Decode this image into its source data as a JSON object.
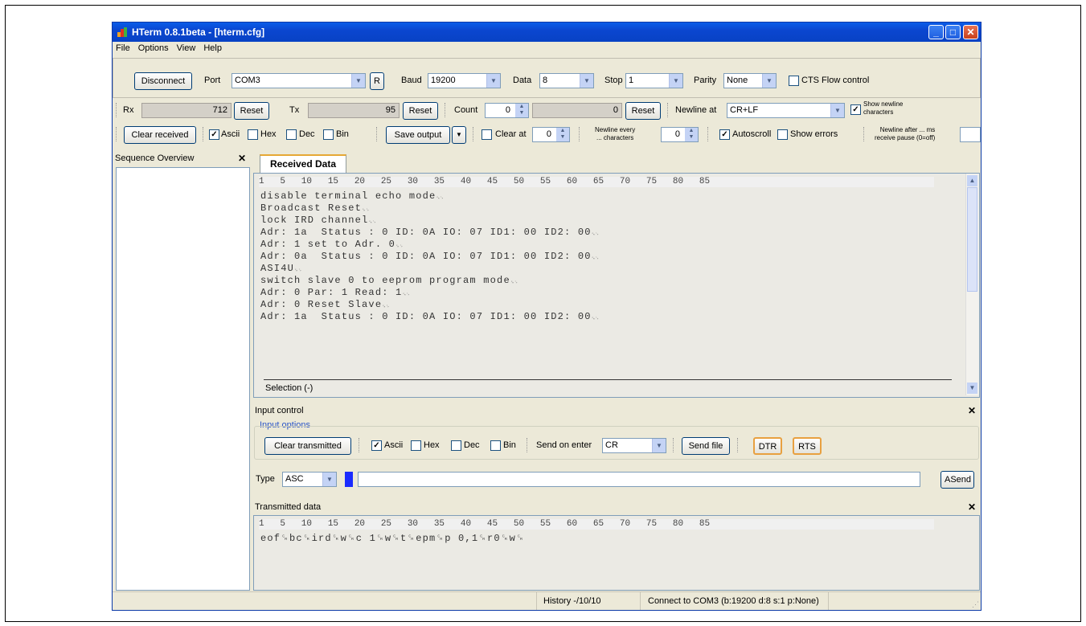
{
  "window": {
    "title": "HTerm 0.8.1beta - [hterm.cfg]",
    "minimize_glyph": "_",
    "maximize_glyph": "□",
    "close_glyph": "✕"
  },
  "menu": {
    "file": "File",
    "options": "Options",
    "view": "View",
    "help": "Help"
  },
  "connection": {
    "disconnect_label": "Disconnect",
    "port_label": "Port",
    "port_value": "COM3",
    "r_label": "R",
    "baud_label": "Baud",
    "baud_value": "19200",
    "data_label": "Data",
    "data_value": "8",
    "stop_label": "Stop",
    "stop_value": "1",
    "parity_label": "Parity",
    "parity_value": "None",
    "cts_label": "CTS Flow control",
    "cts_checked": false
  },
  "counters": {
    "rx_label": "Rx",
    "rx_value": "712",
    "rx_reset": "Reset",
    "tx_label": "Tx",
    "tx_value": "95",
    "tx_reset": "Reset",
    "count_label": "Count",
    "count_value": "0",
    "count_display": "0",
    "count_reset": "Reset",
    "newline_at_label": "Newline at",
    "newline_at_value": "CR+LF",
    "show_newline_label_1": "Show newline",
    "show_newline_label_2": "characters",
    "show_newline_checked": true
  },
  "receive_opts": {
    "clear_received": "Clear received",
    "ascii_label": "Ascii",
    "ascii_checked": true,
    "hex_label": "Hex",
    "dec_label": "Dec",
    "bin_label": "Bin",
    "save_output": "Save output",
    "clear_at_label": "Clear at",
    "clear_at_value": "0",
    "newline_every_1": "Newline every",
    "newline_every_2": "... characters",
    "newline_every_value": "0",
    "autoscroll_label": "Autoscroll",
    "autoscroll_checked": true,
    "show_errors_label": "Show errors",
    "newline_after_1": "Newline after ... ms",
    "newline_after_2": "receive pause (0=off)"
  },
  "sequence_overview": {
    "title": "Sequence Overview",
    "close_glyph": "✕"
  },
  "received": {
    "tab_label": "Received Data",
    "ruler": "1   5   10   15   20   25   30   35   40   45   50   55   60   65   70   75   80   85",
    "lines": [
      "disable terminal echo mode",
      "Broadcast Reset",
      "lock IRD channel",
      "Adr: 1a  Status : 0 ID: 0A IO: 07 ID1: 00 ID2: 00",
      "Adr: 1 set to Adr. 0",
      "Adr: 0a  Status : 0 ID: 0A IO: 07 ID1: 00 ID2: 00",
      "ASI4U",
      "switch slave 0 to eeprom program mode",
      "Adr: 0 Par: 1 Read: 1",
      "Adr: 0 Reset Slave",
      "Adr: 1a  Status : 0 ID: 0A IO: 07 ID1: 00 ID2: 00"
    ],
    "newline_marker": "␍␊",
    "selection_label": "Selection (-)"
  },
  "input_control": {
    "title": "Input control",
    "group_label": "Input options",
    "clear_transmitted": "Clear transmitted",
    "ascii_label": "Ascii",
    "ascii_checked": true,
    "hex_label": "Hex",
    "dec_label": "Dec",
    "bin_label": "Bin",
    "send_on_enter_label": "Send on enter",
    "send_on_enter_value": "CR",
    "send_file": "Send file",
    "dtr_label": "DTR",
    "rts_label": "RTS",
    "type_label": "Type",
    "type_value": "ASC",
    "send_input_value": "",
    "asend_label": "ASend"
  },
  "transmitted": {
    "title": "Transmitted data",
    "ruler": "1   5   10   15   20   25   30   35   40   45   50   55   60   65   70   75   80   85",
    "line": "eof␍bc␍ird␍w␍c 1␍w␍t␍epm␍p 0,1␍r0␍w␍"
  },
  "statusbar": {
    "history": "History -/10/10",
    "connection": "Connect to COM3 (b:19200 d:8 s:1 p:None)"
  },
  "colors": {
    "titlebar": "#0a5ce8",
    "face": "#ece9d8",
    "dtr_rts_border": "#e8a040",
    "cursor_block": "#1a2bff"
  }
}
